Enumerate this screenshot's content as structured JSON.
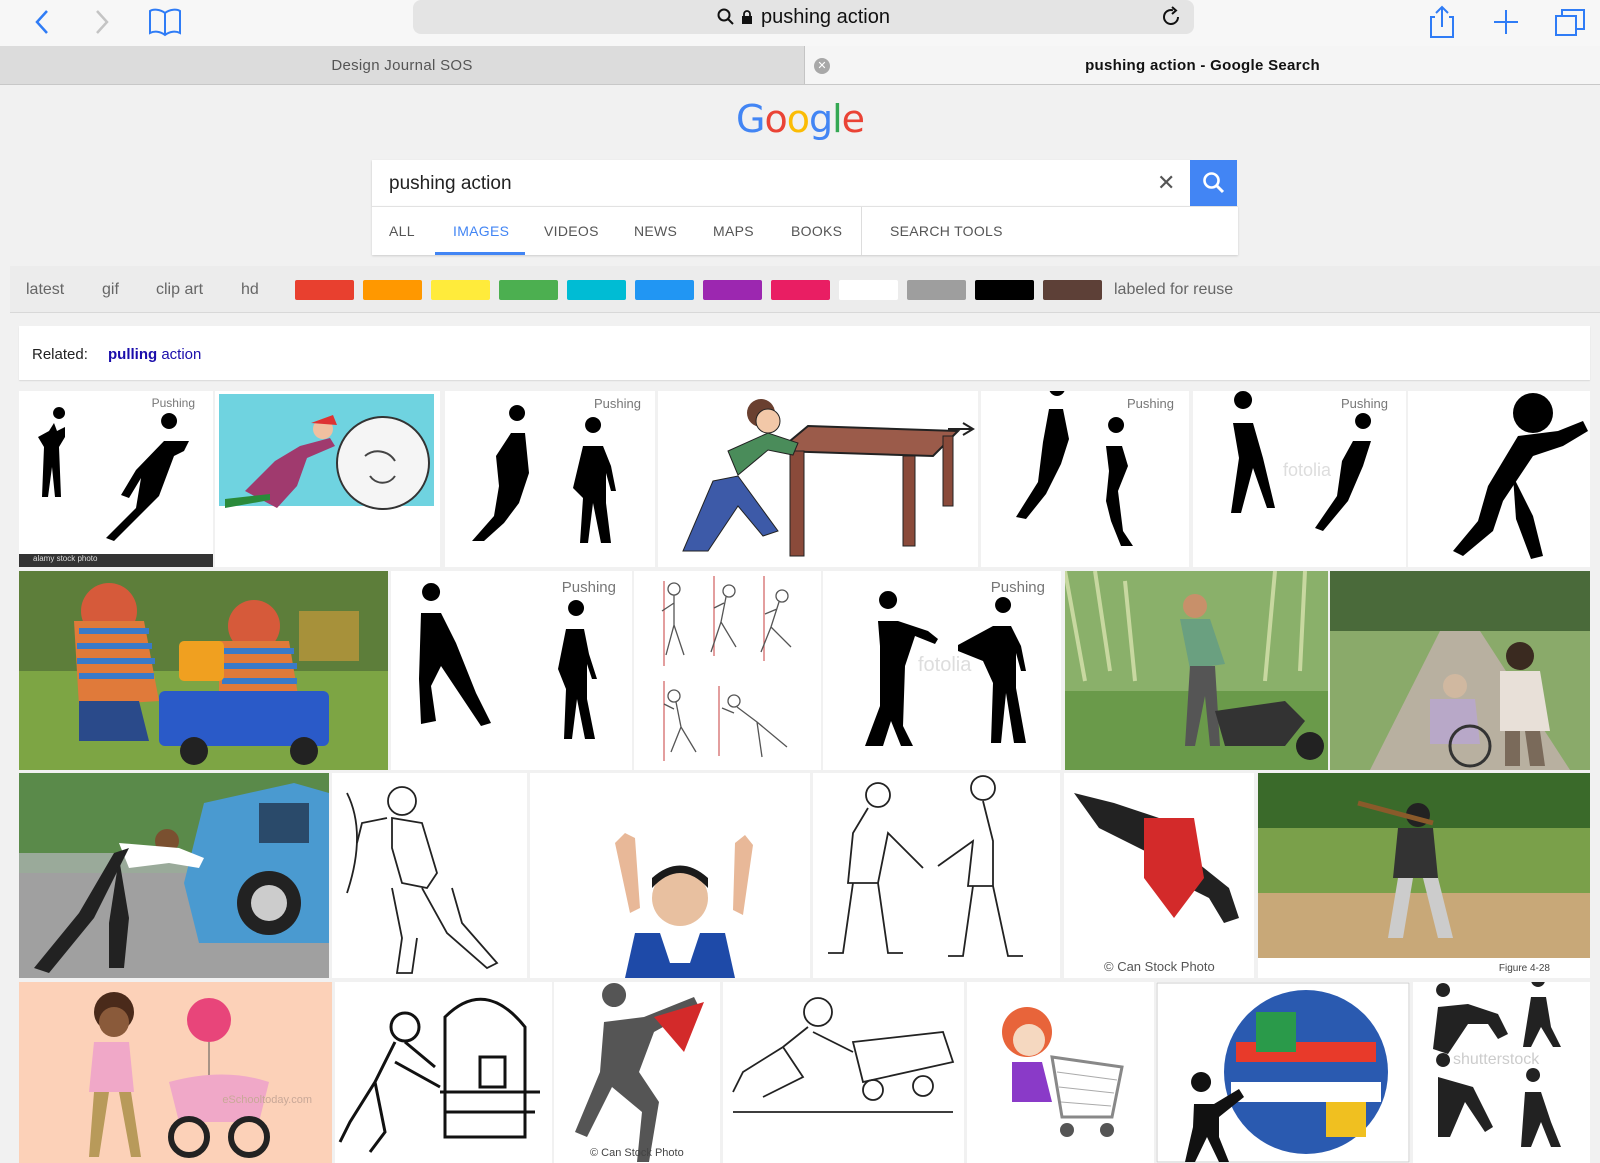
{
  "browser": {
    "url_text": "pushing action",
    "tabs": [
      {
        "label": "Design Journal SOS"
      },
      {
        "label": "pushing action - Google Search"
      }
    ]
  },
  "google": {
    "logo": [
      "G",
      "o",
      "o",
      "g",
      "l",
      "e"
    ],
    "logo_colors": [
      "#4285f4",
      "#ea4335",
      "#fbbc05",
      "#4285f4",
      "#34a853",
      "#ea4335"
    ],
    "query": "pushing action",
    "nav_tabs": [
      "ALL",
      "IMAGES",
      "VIDEOS",
      "NEWS",
      "MAPS",
      "BOOKS"
    ],
    "search_tools": "SEARCH TOOLS",
    "active_tab": "IMAGES"
  },
  "filters": {
    "chips": [
      "latest",
      "gif",
      "clip art",
      "hd"
    ],
    "color_swatches": [
      "#e8402f",
      "#ff9800",
      "#ffeb3b",
      "#4caf50",
      "#00bcd4",
      "#2196f3",
      "#9c27b0",
      "#e91e63",
      "#ffffff",
      "#9e9e9e",
      "#000000",
      "#5d4037"
    ],
    "reuse": "labeled for reuse"
  },
  "related": {
    "label": "Related:",
    "bold": "pulling",
    "rest": " action"
  },
  "watermarks": {
    "pushing": "Pushing",
    "alamy": "alamy stock photo",
    "fotolia": "fotolia",
    "canstock": "© Can Stock Photo",
    "figure": "Figure 4-28",
    "eschool": "eSchooltoday.com",
    "shutterstock": "shutterstock"
  }
}
